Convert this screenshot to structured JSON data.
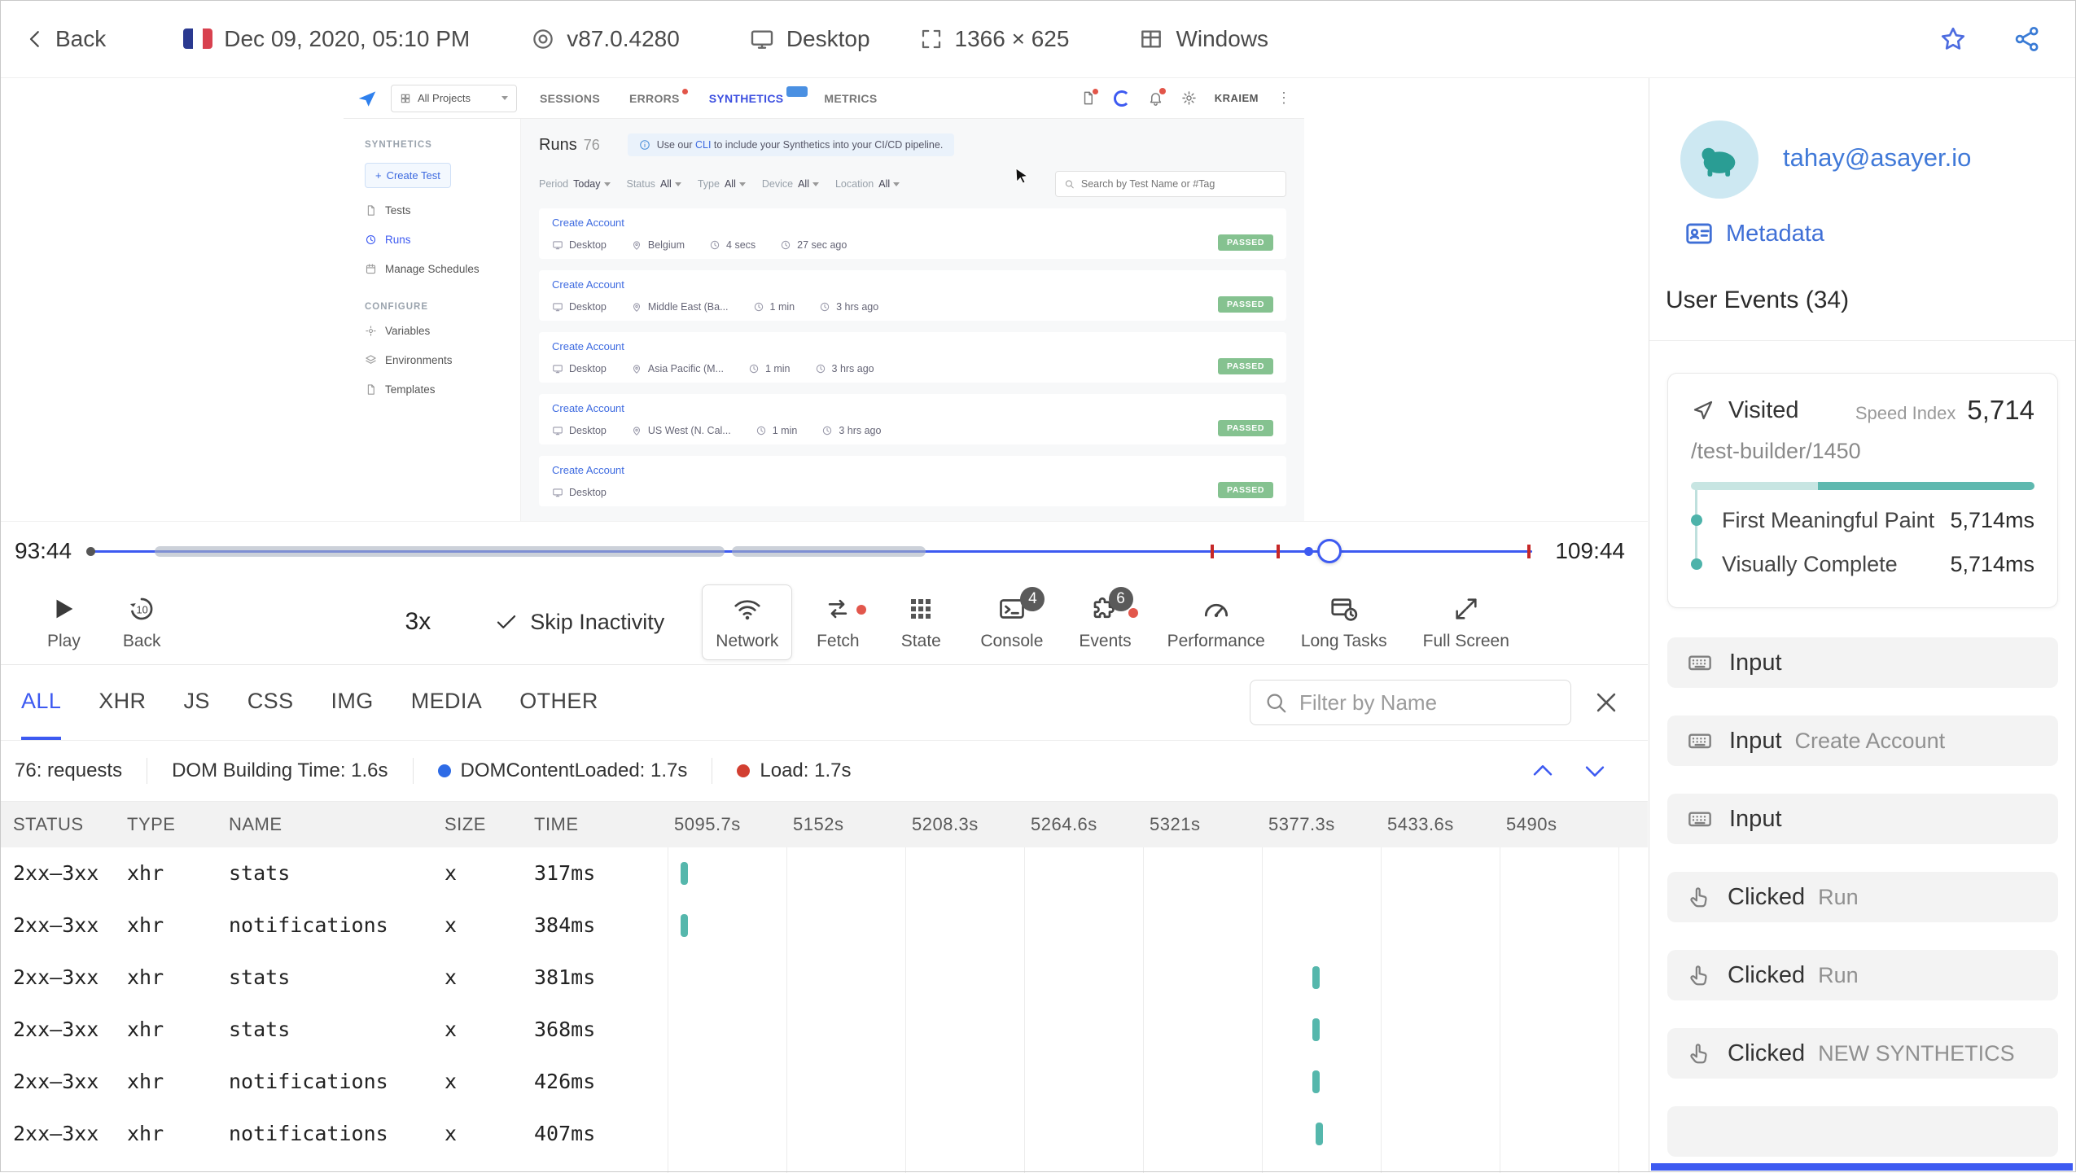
{
  "topbar": {
    "back_label": "Back",
    "session_date": "Dec 09, 2020, 05:10 PM",
    "browser_version": "v87.0.4280",
    "device": "Desktop",
    "resolution": "1366 × 625",
    "os": "Windows"
  },
  "app": {
    "projects": "All Projects",
    "tabs": [
      "SESSIONS",
      "ERRORS",
      "SYNTHETICS",
      "METRICS"
    ],
    "user": "KRAIEM",
    "side": {
      "section_synthetics": "SYNTHETICS",
      "create_test": "Create Test",
      "tests": "Tests",
      "runs": "Runs",
      "manage_schedules": "Manage Schedules",
      "section_configure": "CONFIGURE",
      "variables": "Variables",
      "environments": "Environments",
      "templates": "Templates"
    },
    "main": {
      "title": "Runs",
      "count": "76",
      "banner_pre": "Use our ",
      "banner_link": "CLI",
      "banner_post": " to include your Synthetics into your CI/CD pipeline.",
      "filters": [
        {
          "label": "Period",
          "value": "Today"
        },
        {
          "label": "Status",
          "value": "All"
        },
        {
          "label": "Type",
          "value": "All"
        },
        {
          "label": "Device",
          "value": "All"
        },
        {
          "label": "Location",
          "value": "All"
        }
      ],
      "search_placeholder": "Search by Test Name or #Tag",
      "runs": [
        {
          "name": "Create Account",
          "device": "Desktop",
          "location": "Belgium",
          "duration": "4 secs",
          "ago": "27 sec ago",
          "status": "PASSED"
        },
        {
          "name": "Create Account",
          "device": "Desktop",
          "location": "Middle East (Ba...",
          "duration": "1 min",
          "ago": "3 hrs ago",
          "status": "PASSED"
        },
        {
          "name": "Create Account",
          "device": "Desktop",
          "location": "Asia Pacific (M...",
          "duration": "1 min",
          "ago": "3 hrs ago",
          "status": "PASSED"
        },
        {
          "name": "Create Account",
          "device": "Desktop",
          "location": "US West (N. Cal...",
          "duration": "1 min",
          "ago": "3 hrs ago",
          "status": "PASSED"
        },
        {
          "name": "Create Account",
          "device": "Desktop",
          "location": "",
          "duration": "",
          "ago": "",
          "status": "PASSED"
        }
      ]
    }
  },
  "player": {
    "current_time": "93:44",
    "total_time": "109:44",
    "speed": "3x",
    "skip_inactivity": "Skip Inactivity",
    "play": "Play",
    "back": "Back",
    "back_seconds": "10",
    "buttons": [
      {
        "label": "Network"
      },
      {
        "label": "Fetch"
      },
      {
        "label": "State"
      },
      {
        "label": "Console",
        "badge": "4"
      },
      {
        "label": "Events",
        "badge": "6"
      },
      {
        "label": "Performance"
      },
      {
        "label": "Long Tasks"
      },
      {
        "label": "Full Screen"
      }
    ]
  },
  "network": {
    "tabs": [
      "ALL",
      "XHR",
      "JS",
      "CSS",
      "IMG",
      "MEDIA",
      "OTHER"
    ],
    "filter_placeholder": "Filter by Name",
    "summary": {
      "requests": "76: requests",
      "dom_building": "DOM Building Time: 1.6s",
      "dcl": "DOMContentLoaded: 1.7s",
      "load": "Load: 1.7s"
    },
    "headers": [
      "STATUS",
      "TYPE",
      "NAME",
      "SIZE",
      "TIME"
    ],
    "ticks": [
      "5095.7s",
      "5152s",
      "5208.3s",
      "5264.6s",
      "5321s",
      "5377.3s",
      "5433.6s",
      "5490s"
    ],
    "rows": [
      {
        "status": "2xx–3xx",
        "type": "xhr",
        "name": "stats",
        "size": "x",
        "time": "317ms"
      },
      {
        "status": "2xx–3xx",
        "type": "xhr",
        "name": "notifications",
        "size": "x",
        "time": "384ms"
      },
      {
        "status": "2xx–3xx",
        "type": "xhr",
        "name": "stats",
        "size": "x",
        "time": "381ms"
      },
      {
        "status": "2xx–3xx",
        "type": "xhr",
        "name": "stats",
        "size": "x",
        "time": "368ms"
      },
      {
        "status": "2xx–3xx",
        "type": "xhr",
        "name": "notifications",
        "size": "x",
        "time": "426ms"
      },
      {
        "status": "2xx–3xx",
        "type": "xhr",
        "name": "notifications",
        "size": "x",
        "time": "407ms"
      }
    ]
  },
  "user": {
    "email": "tahay@asayer.io",
    "metadata": "Metadata",
    "events_title": "User Events (34)",
    "visited": {
      "label": "Visited",
      "speed_index_label": "Speed Index",
      "speed_index": "5,714",
      "url": "/test-builder/1450",
      "metrics": [
        {
          "name": "First Meaningful Paint",
          "value": "5,714ms"
        },
        {
          "name": "Visually Complete",
          "value": "5,714ms"
        }
      ]
    },
    "events": [
      {
        "type": "Input",
        "value": ""
      },
      {
        "type": "Input",
        "value": "Create Account"
      },
      {
        "type": "Input",
        "value": ""
      },
      {
        "type": "Clicked",
        "value": "Run"
      },
      {
        "type": "Clicked",
        "value": "Run"
      },
      {
        "type": "Clicked",
        "value": "NEW SYNTHETICS"
      }
    ]
  },
  "colors": {
    "accent": "#3d5af1",
    "teal_bar": "#55b7ac",
    "passed_green": "#85c290",
    "link_blue": "#3d6ae0"
  }
}
